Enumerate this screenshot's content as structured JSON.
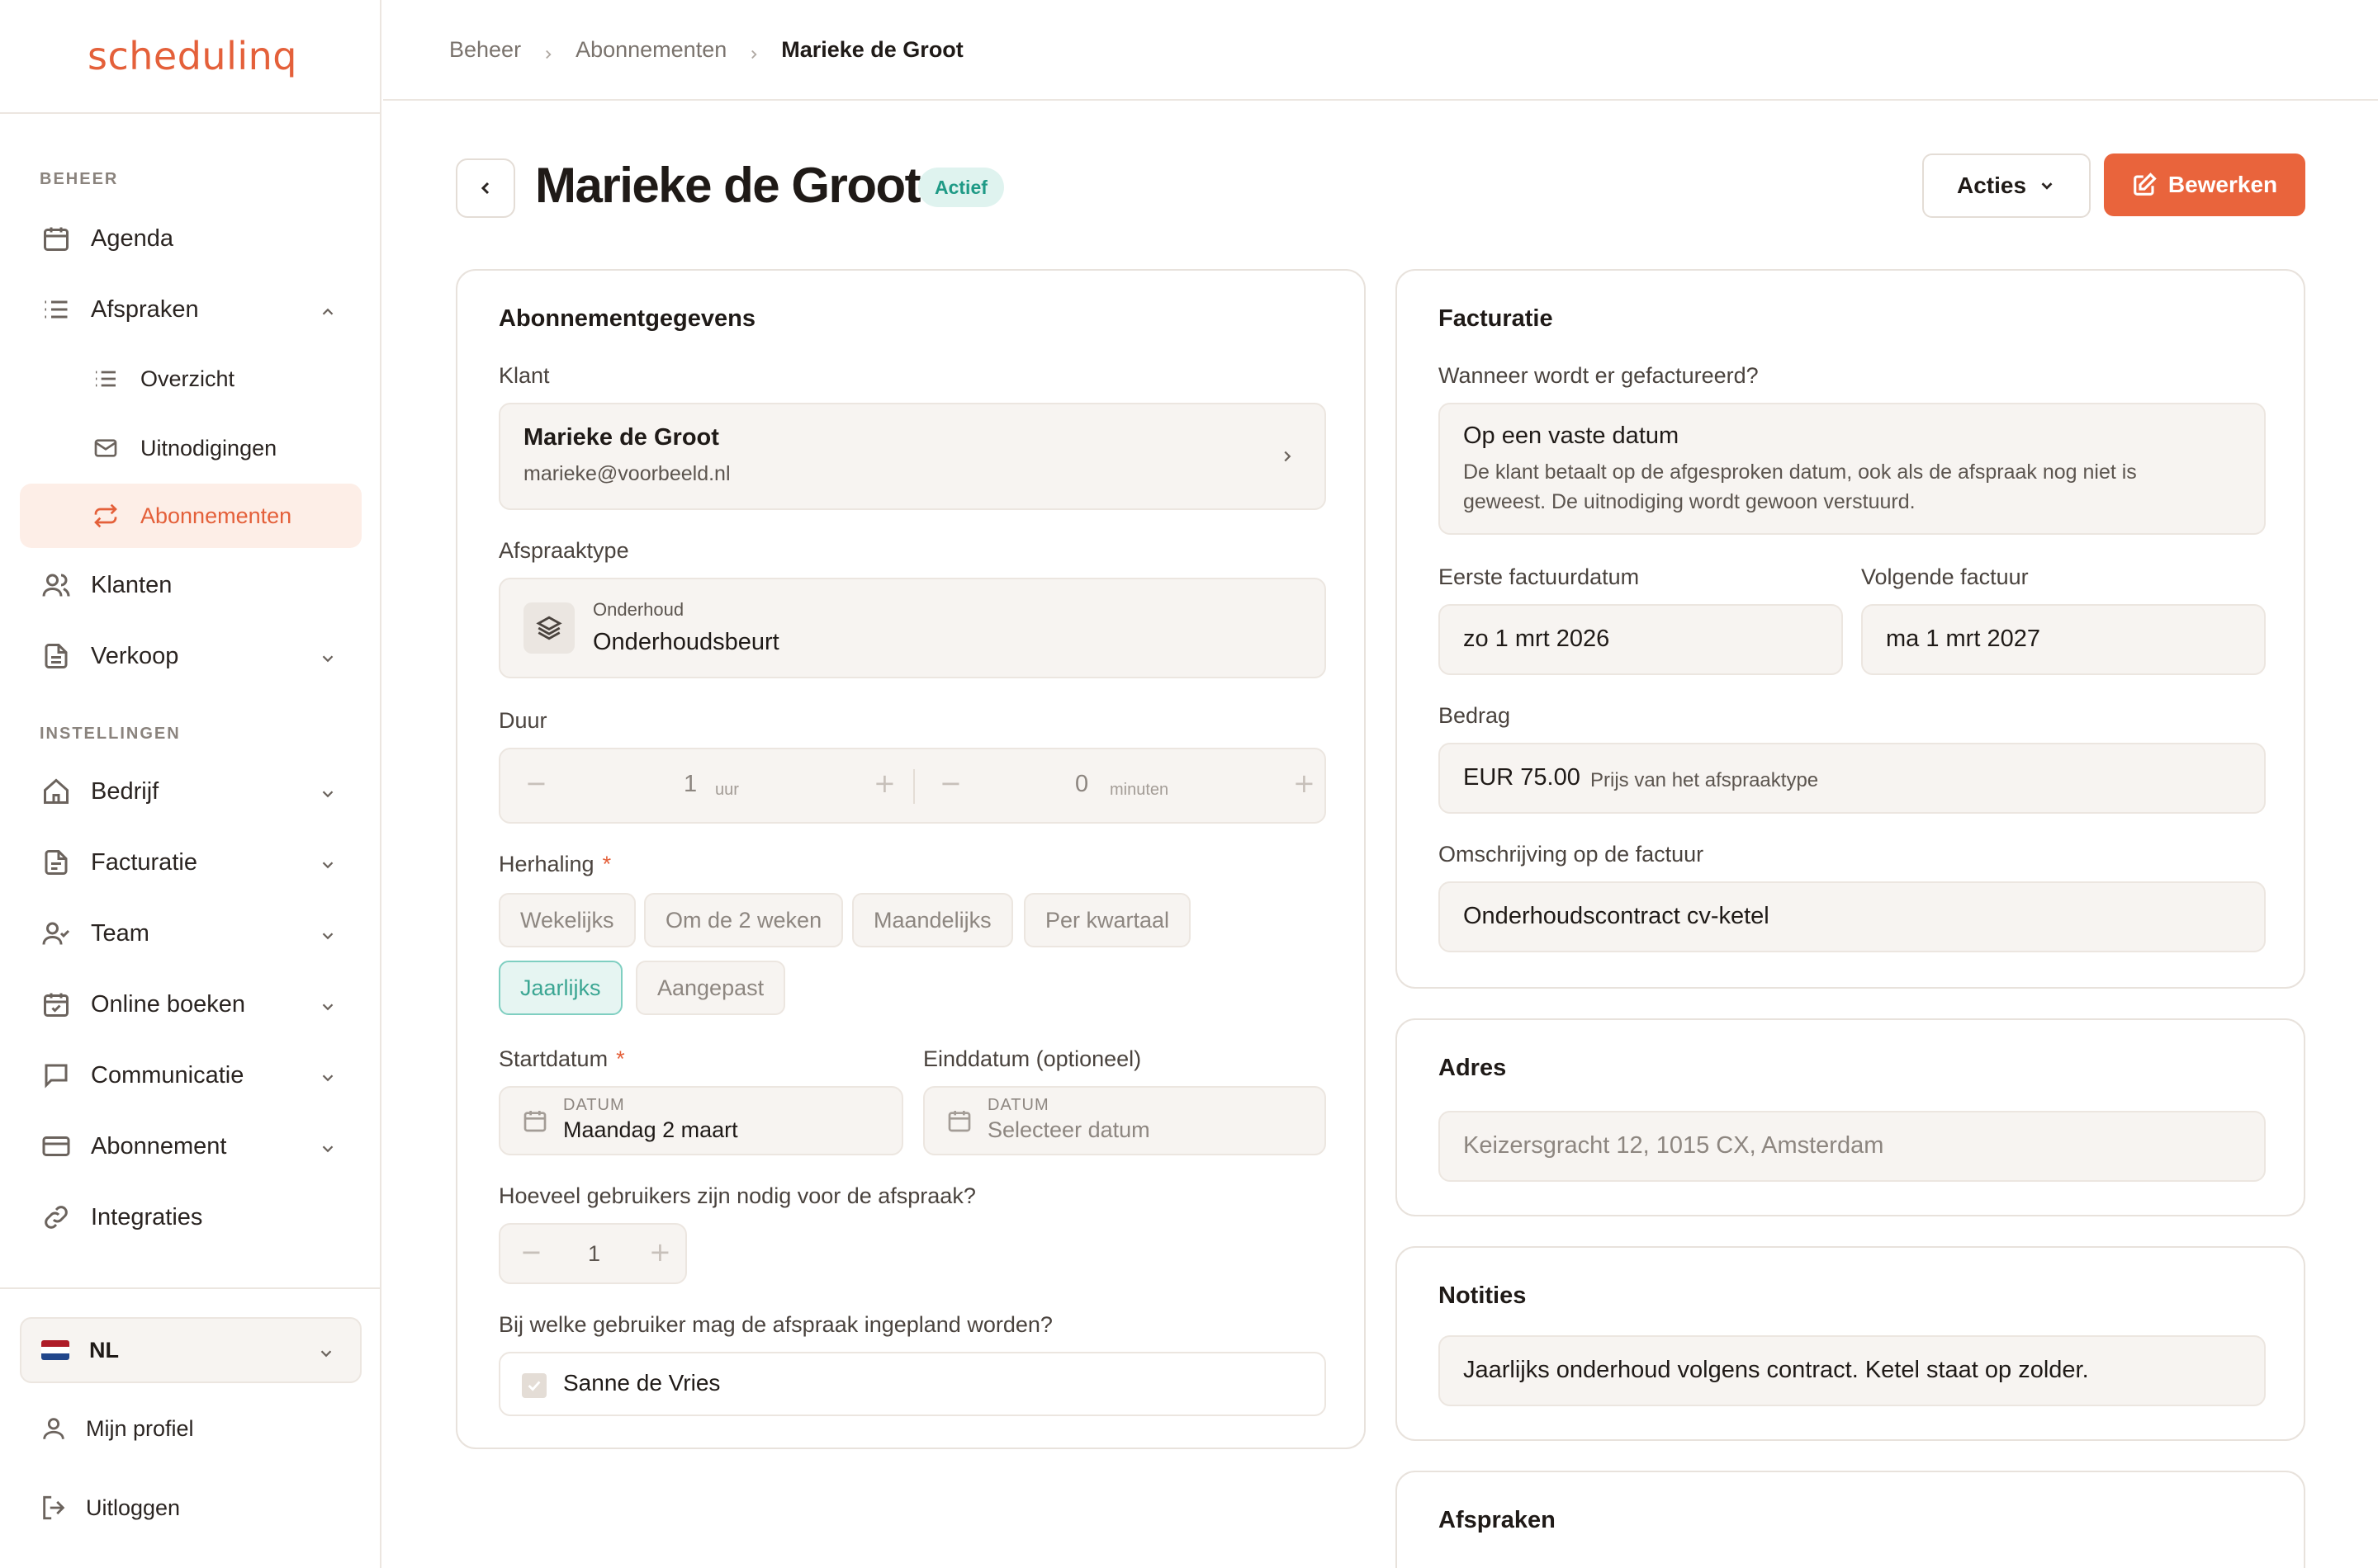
{
  "app": {
    "logo": "schedulinq"
  },
  "sidebar": {
    "section_beheer": "BEHEER",
    "section_instellingen": "INSTELLINGEN",
    "items": {
      "agenda": "Agenda",
      "afspraken": "Afspraken",
      "overzicht": "Overzicht",
      "uitnodigingen": "Uitnodigingen",
      "abonnementen": "Abonnementen",
      "klanten": "Klanten",
      "verkoop": "Verkoop",
      "bedrijf": "Bedrijf",
      "facturatie": "Facturatie",
      "team": "Team",
      "online_boeken": "Online boeken",
      "communicatie": "Communicatie",
      "abonnement": "Abonnement",
      "integraties": "Integraties"
    },
    "language": "NL",
    "profile": "Mijn profiel",
    "logout": "Uitloggen"
  },
  "breadcrumb": [
    "Beheer",
    "Abonnementen",
    "Marieke de Groot"
  ],
  "header": {
    "title": "Marieke de Groot",
    "status": "Actief",
    "actions_label": "Acties",
    "edit_label": "Bewerken"
  },
  "subscription": {
    "title": "Abonnementgegevens",
    "client_label": "Klant",
    "client_name": "Marieke de Groot",
    "client_email": "marieke@voorbeeld.nl",
    "type_label": "Afspraaktype",
    "type_category": "Onderhoud",
    "type_name": "Onderhoudsbeurt",
    "duration_label": "Duur",
    "duration_hours": "1",
    "duration_hours_unit": "uur",
    "duration_minutes": "0",
    "duration_minutes_unit": "minuten",
    "repeat_label": "Herhaling",
    "repeat_options": [
      "Wekelijks",
      "Om de 2 weken",
      "Maandelijks",
      "Per kwartaal",
      "Jaarlijks",
      "Aangepast"
    ],
    "repeat_selected": "Jaarlijks",
    "start_label": "Startdatum",
    "start_caption": "DATUM",
    "start_value": "Maandag 2 maart",
    "end_label": "Einddatum (optioneel)",
    "end_caption": "DATUM",
    "end_placeholder": "Selecteer datum",
    "users_needed_label": "Hoeveel gebruikers zijn nodig voor de afspraak?",
    "users_needed_value": "1",
    "assign_label": "Bij welke gebruiker mag de afspraak ingepland worden?",
    "assign_user": "Sanne de Vries"
  },
  "billing": {
    "title": "Facturatie",
    "when_label": "Wanneer wordt er gefactureerd?",
    "when_value": "Op een vaste datum",
    "when_description": "De klant betaalt op de afgesproken datum, ook als de afspraak nog niet is gewеest. De uitnodiging wordt gewoon verstuurd.",
    "first_invoice_label": "Eerste factuurdatum",
    "first_invoice_value": "zo 1 mrt 2026",
    "next_invoice_label": "Volgende factuur",
    "next_invoice_value": "ma 1 mrt 2027",
    "amount_label": "Bedrag",
    "amount_value": "EUR 75.00",
    "amount_note": "Prijs van het afspraaktype",
    "description_label": "Omschrijving op de factuur",
    "description_value": "Onderhoudscontract cv-ketel"
  },
  "address": {
    "title": "Adres",
    "value": "Keizersgracht 12, 1015 CX, Amsterdam"
  },
  "notes": {
    "title": "Notities",
    "value": "Jaarlijks onderhoud volgens contract. Ketel staat op zolder."
  },
  "appointments": {
    "title": "Afspraken"
  },
  "colors": {
    "accent": "#e9643c",
    "status_green": "#1f9a86",
    "field_bg": "#f7f4f1"
  }
}
